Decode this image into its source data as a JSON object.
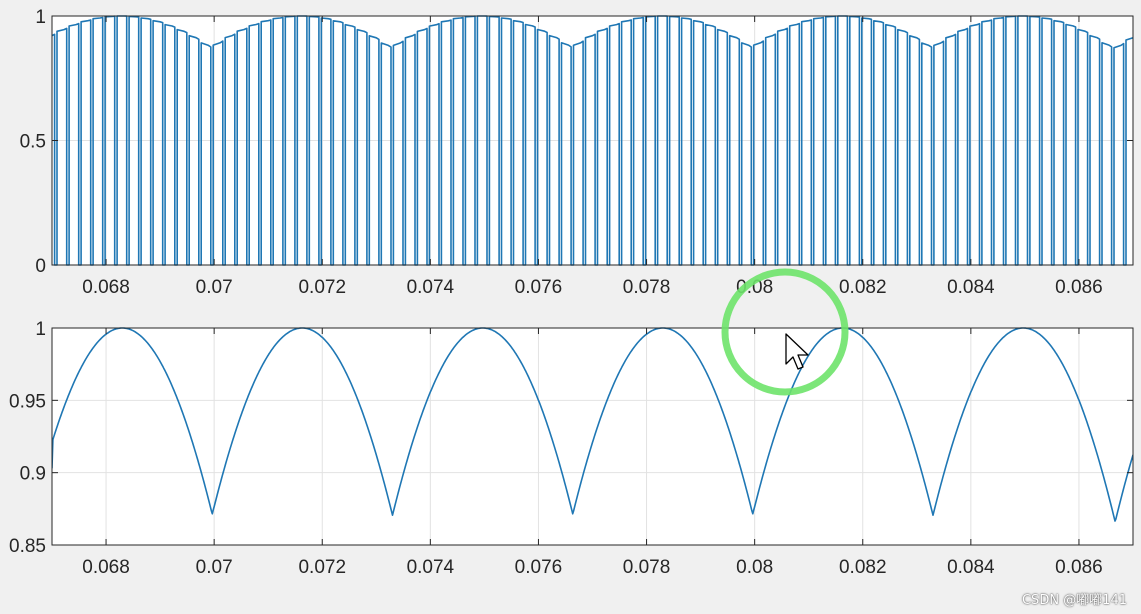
{
  "chart_data": [
    {
      "type": "line",
      "title": "",
      "xlabel": "",
      "ylabel": "",
      "xlim": [
        0.067,
        0.087
      ],
      "ylim": [
        0,
        1
      ],
      "x_ticks": [
        0.068,
        0.07,
        0.072,
        0.074,
        0.076,
        0.078,
        0.08,
        0.082,
        0.084,
        0.086
      ],
      "x_tick_labels": [
        "0.068",
        "0.07",
        "0.072",
        "0.074",
        "0.076",
        "0.078",
        "0.08",
        "0.082",
        "0.084",
        "0.086"
      ],
      "y_ticks": [
        0,
        0.5,
        1
      ],
      "y_tick_labels": [
        "0",
        "0.5",
        "1"
      ],
      "grid": true,
      "series": [
        {
          "style": "pwm-pulses",
          "pulse_low": 0,
          "pulse_count": 90,
          "envelope": {
            "x_peaks": [
              0.0683,
              0.07163,
              0.07497,
              0.0783,
              0.08163,
              0.08497
            ],
            "x_minima": [
              0.07,
              0.07333,
              0.07667,
              0.08,
              0.08333,
              0.08667
            ],
            "peak_value": 1,
            "minimum_value": 0.866
          }
        }
      ]
    },
    {
      "type": "line",
      "title": "",
      "xlabel": "",
      "ylabel": "",
      "xlim": [
        0.067,
        0.087
      ],
      "ylim": [
        0.85,
        1
      ],
      "x_ticks": [
        0.068,
        0.07,
        0.072,
        0.074,
        0.076,
        0.078,
        0.08,
        0.082,
        0.084,
        0.086
      ],
      "x_tick_labels": [
        "0.068",
        "0.07",
        "0.072",
        "0.074",
        "0.076",
        "0.078",
        "0.08",
        "0.082",
        "0.084",
        "0.086"
      ],
      "y_ticks": [
        0.85,
        0.9,
        0.95,
        1
      ],
      "y_tick_labels": [
        "0.85",
        "0.9",
        "0.95",
        "1"
      ],
      "grid": true,
      "series": [
        {
          "style": "rectified-envelope",
          "x_peaks": [
            0.0683,
            0.07163,
            0.07497,
            0.0783,
            0.08163,
            0.08497
          ],
          "x_minima": [
            0.07,
            0.07333,
            0.07667,
            0.08,
            0.08333,
            0.08667
          ],
          "peak_value": 1,
          "minimum_value": 0.866,
          "start": [
            0.067,
            0.903
          ],
          "end": [
            0.087,
            0.91
          ]
        }
      ]
    }
  ],
  "colors": {
    "line": "#1f77b4",
    "highlight_circle": "#6ee36a",
    "background": "#f0f0f0"
  },
  "overlay": {
    "cursor_icon": "mouse-pointer-icon",
    "highlight": "green-circle-highlight"
  },
  "watermark": "CSDN @嘟嘟141"
}
